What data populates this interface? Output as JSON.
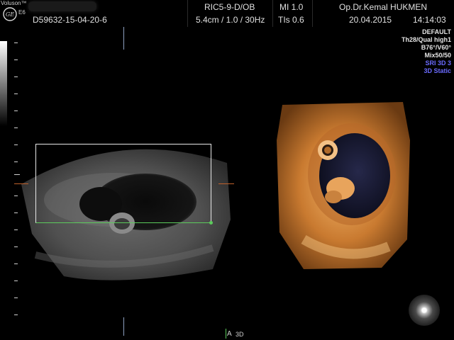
{
  "header": {
    "brand": "Voluson™",
    "model": "E6",
    "patient_id": "D59632-15-04-20-6",
    "probe": "RIC5-9-D/OB",
    "depth_info": "5.4cm / 1.0 / 30Hz",
    "mi": "MI  1.0",
    "tis": "TIs  0.6",
    "operator": "Op.Dr.Kemal HUKMEN",
    "date": "20.04.2015",
    "time": "14:14:03"
  },
  "settings": [
    {
      "text": "DEFAULT",
      "color": "#e6e6e6"
    },
    {
      "text": "Th28/Qual high1",
      "color": "#e6e6e6"
    },
    {
      "text": "B76°/V60°",
      "color": "#e6e6e6"
    },
    {
      "text": "Mix50/50",
      "color": "#e6e6e6"
    },
    {
      "text": "SRI 3D 3",
      "color": "#6b6bff"
    },
    {
      "text": "3D Static",
      "color": "#6b6bff"
    }
  ],
  "bottom": {
    "mode_a": "A",
    "mode_3d": "3D"
  },
  "colors": {
    "roi_border": "#e8e8e8",
    "roi_green": "#5ccb5c",
    "marker_orange": "#c0602a",
    "render_orange": "#d98a3a"
  },
  "icons": {
    "logo": "ge-logo-icon",
    "orientation": "orientation-orb-icon"
  }
}
